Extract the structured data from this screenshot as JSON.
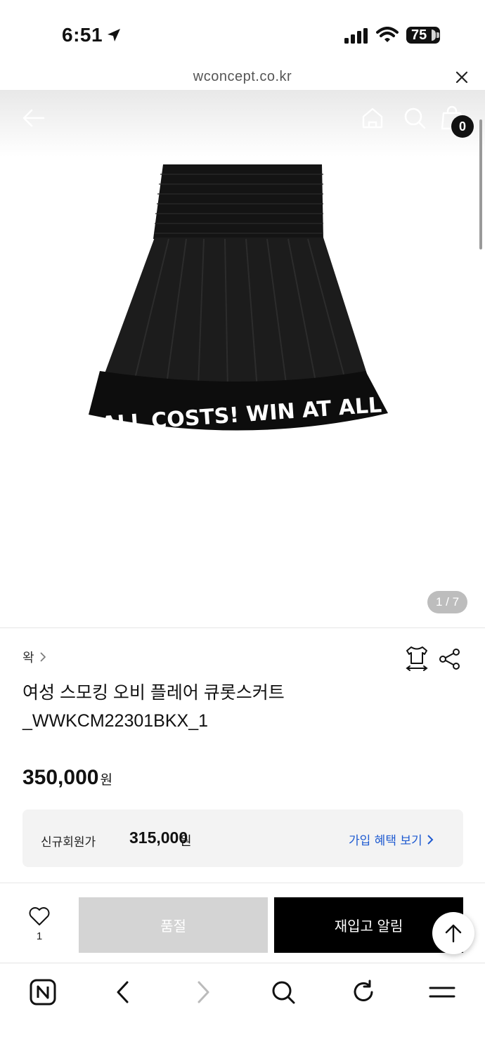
{
  "status_bar": {
    "time": "6:51",
    "battery": "75"
  },
  "browser": {
    "url": "wconcept.co.kr"
  },
  "header": {
    "cart_count": "0"
  },
  "gallery": {
    "counter": "1 / 7",
    "print_text": "WIN AT ALL COSTS! WIN AT ALL COSTS!"
  },
  "product": {
    "brand": "왁",
    "title_line1": "여성 스모킹 오비 플레어 큐롯스커트",
    "title_line2": "_WWKCM22301BKX_1",
    "price": "350,000",
    "price_unit": "원",
    "member_label": "신규회원가",
    "member_price": "315,000",
    "member_unit": "원",
    "benefit_link": "가입 혜택 보기"
  },
  "actions": {
    "wish_count": "1",
    "soldout_label": "품절",
    "restock_label": "재입고 알림"
  },
  "colors": {
    "accent_link": "#1f5bd1",
    "primary_button": "#000000",
    "disabled_button": "#d4d4d4"
  }
}
